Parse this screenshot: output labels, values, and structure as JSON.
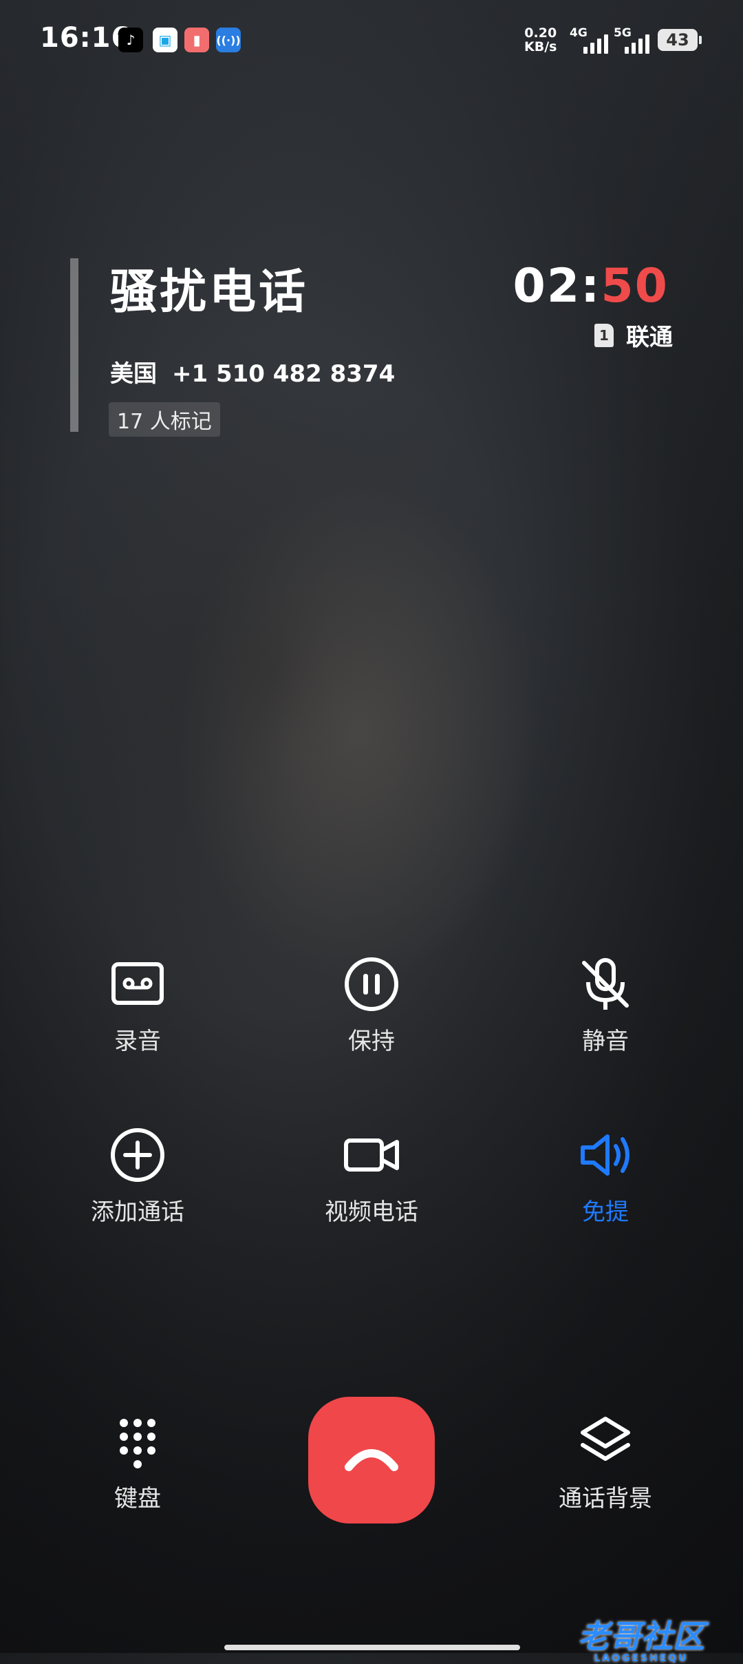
{
  "status_bar": {
    "time": "16:16",
    "net_speed_value": "0.20",
    "net_speed_unit": "KB/s",
    "sim1_label": "4G",
    "sim2_label": "5G",
    "battery": "43",
    "app_icons": [
      "tiktok-icon",
      "chat-app-icon",
      "cylinder-app-icon",
      "hotspot-icon"
    ]
  },
  "caller": {
    "name": "骚扰电话",
    "region": "美国",
    "number": "+1 510 482 8374",
    "tag": "17 人标记"
  },
  "call": {
    "timer_min": "02:",
    "timer_sec": "50",
    "sim_slot": "1",
    "carrier": "联通"
  },
  "controls": {
    "record": "录音",
    "hold": "保持",
    "mute": "静音",
    "add_call": "添加通话",
    "video_call": "视频电话",
    "speaker": "免提",
    "keypad": "键盘",
    "call_background": "通话背景"
  },
  "watermark": {
    "text": "老哥社区",
    "sub": "LAOGESHEQU"
  },
  "colors": {
    "end_call": "#f0474a",
    "active": "#1f7aff",
    "timer_seconds": "#ef4b4b"
  }
}
